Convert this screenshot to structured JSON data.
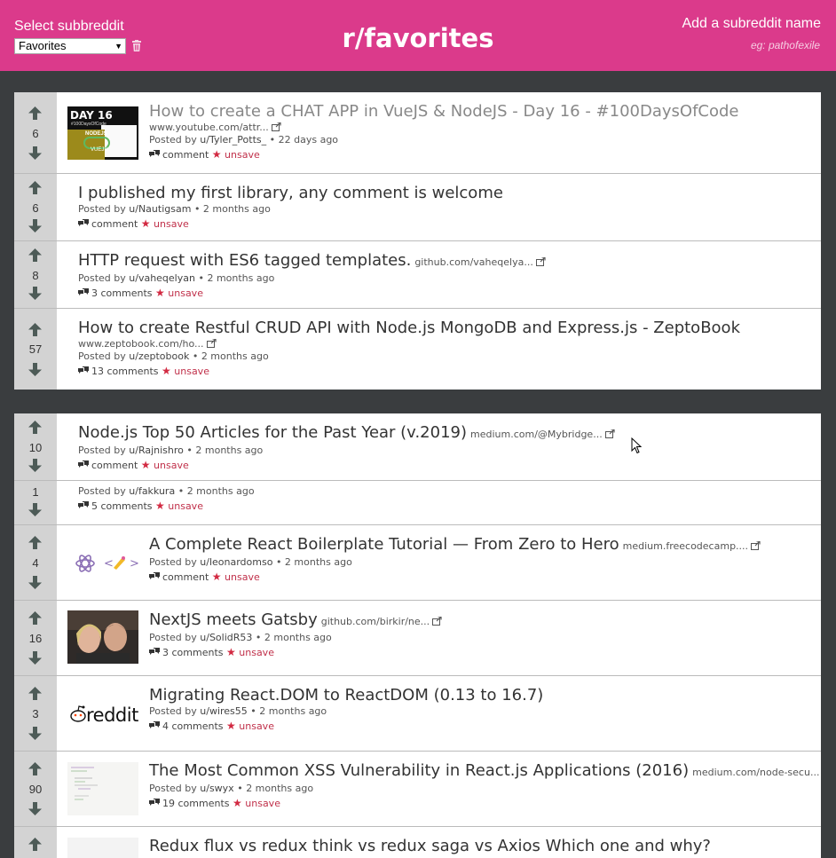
{
  "header": {
    "select_label": "Select subbreddit",
    "selected_value": "Favorites",
    "title": "r/favorites",
    "add_label": "Add a subreddit name",
    "add_placeholder": "eg: pathofexile"
  },
  "icons": {
    "upvote": "arrow-up-icon",
    "downvote": "arrow-down-icon",
    "comment": "comment-icon",
    "external": "external-link-icon",
    "star": "star-icon",
    "trash": "trash-icon"
  },
  "colors": {
    "header": "#db3a8b",
    "unsave": "#c0304a",
    "background": "#3a3d3f"
  },
  "posts": [
    {
      "score": "6",
      "title": "How to create a CHAT APP in VueJS & NodeJS - Day 16 - #100DaysOfCode",
      "domain": "www.youtube.com/attr...",
      "posted_by": "Posted by",
      "author": "u/Tyler_Potts_",
      "time": "• 22 days ago",
      "comments": "comment",
      "unsave": "unsave",
      "thumb": {
        "day": "DAY 16",
        "tag": "#100DaysOfCode",
        "node": "NODEJS",
        "vue": "VUEJS"
      }
    },
    {
      "score": "6",
      "title": "I published my first library, any comment is welcome",
      "posted_by": "Posted by",
      "author": "u/Nautigsam",
      "time": "• 2 months ago",
      "comments": "comment",
      "unsave": "unsave"
    },
    {
      "score": "8",
      "title": "HTTP request with ES6 tagged templates.",
      "domain": "github.com/vaheqelya...",
      "posted_by": "Posted by",
      "author": "u/vaheqelyan",
      "time": "• 2 months ago",
      "comments": "3 comments",
      "unsave": "unsave"
    },
    {
      "score": "57",
      "title": "How to create Restful CRUD API with Node.js MongoDB and Express.js - ZeptoBook",
      "domain": "www.zeptobook.com/ho...",
      "posted_by": "Posted by",
      "author": "u/zeptobook",
      "time": "• 2 months ago",
      "comments": "13 comments",
      "unsave": "unsave"
    },
    {
      "score": "10",
      "title": "Node.js Top 50 Articles for the Past Year (v.2019)",
      "domain": "medium.com/@Mybridge...",
      "posted_by": "Posted by",
      "author": "u/Rajnishro",
      "time": "• 2 months ago",
      "comments": "comment",
      "unsave": "unsave"
    },
    {
      "score": "1",
      "posted_by": "Posted by",
      "author": "u/fakkura",
      "time": "• 2 months ago",
      "comments": "5 comments",
      "unsave": "unsave"
    },
    {
      "score": "4",
      "title": "A Complete React Boilerplate Tutorial — From Zero to Hero",
      "domain": "medium.freecodecamp....",
      "posted_by": "Posted by",
      "author": "u/leonardomso",
      "time": "• 2 months ago",
      "comments": "comment",
      "unsave": "unsave"
    },
    {
      "score": "16",
      "title": "NextJS meets Gatsby",
      "domain": "github.com/birkir/ne...",
      "posted_by": "Posted by",
      "author": "u/SolidR53",
      "time": "• 2 months ago",
      "comments": "3 comments",
      "unsave": "unsave"
    },
    {
      "score": "3",
      "title": "Migrating React.DOM to ReactDOM (0.13 to 16.7)",
      "posted_by": "Posted by",
      "author": "u/wires55",
      "time": "• 2 months ago",
      "comments": "4 comments",
      "unsave": "unsave",
      "thumb": {
        "logo": "reddit"
      }
    },
    {
      "score": "90",
      "title": "The Most Common XSS Vulnerability in React.js Applications (2016)",
      "domain": "medium.com/node-secu...",
      "posted_by": "Posted by",
      "author": "u/swyx",
      "time": "• 2 months ago",
      "comments": "19 comments",
      "unsave": "unsave"
    },
    {
      "title": "Redux flux vs redux think vs redux saga vs Axios Which one and why?"
    }
  ]
}
